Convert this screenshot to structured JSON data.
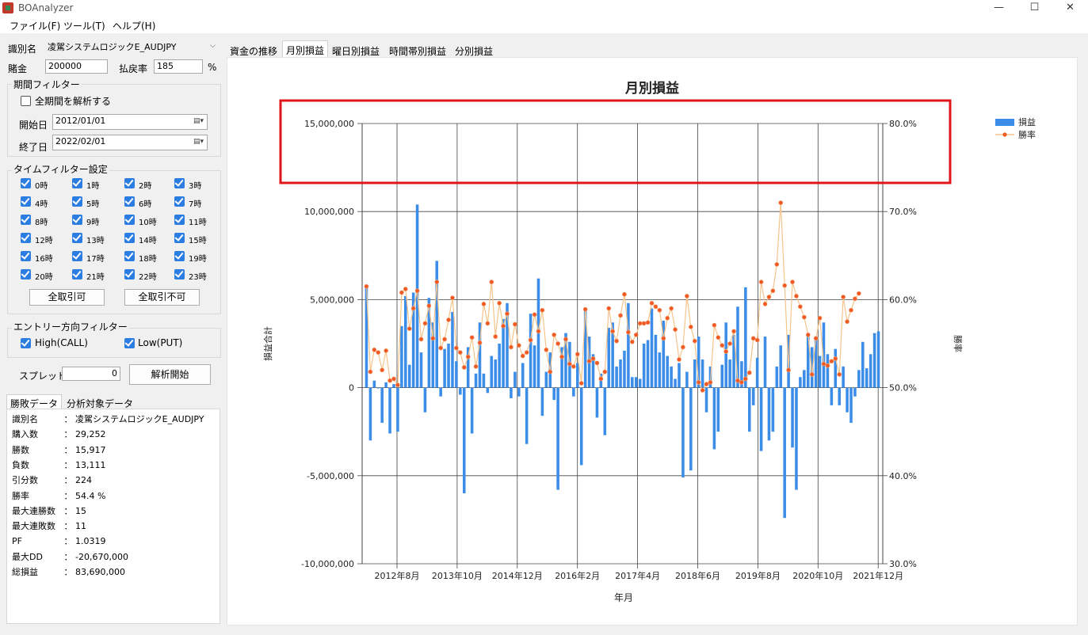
{
  "window": {
    "title": "BOAnalyzer"
  },
  "menu": [
    "ファイル(F)",
    "ツール(T)",
    "ヘルプ(H)"
  ],
  "controls": {
    "id_label": "識別名",
    "id_value": "凌駕システムロジックE_AUDJPY",
    "stake_label": "賭金",
    "stake_value": "200000",
    "payout_label": "払戻率",
    "payout_value": "185",
    "payout_unit": "%"
  },
  "period_filter": {
    "title": "期間フィルター",
    "all_period_label": "全期間を解析する",
    "all_period_checked": false,
    "start_label": "開始日",
    "start_value": "2012/01/01",
    "end_label": "終了日",
    "end_value": "2022/02/01"
  },
  "time_filter": {
    "title": "タイムフィルター設定",
    "hours": [
      "0時",
      "1時",
      "2時",
      "3時",
      "4時",
      "5時",
      "6時",
      "7時",
      "8時",
      "9時",
      "10時",
      "11時",
      "12時",
      "13時",
      "14時",
      "15時",
      "16時",
      "17時",
      "18時",
      "19時",
      "20時",
      "21時",
      "22時",
      "23時"
    ],
    "allow_all": "全取引可",
    "deny_all": "全取引不可"
  },
  "entry_filter": {
    "title": "エントリー方向フィルター",
    "high_label": "High(CALL)",
    "low_label": "Low(PUT)"
  },
  "spread": {
    "label": "スプレッド",
    "value": "0",
    "analyze_button": "解析開始"
  },
  "stats_tabs": [
    "勝敗データ",
    "分析対象データ"
  ],
  "stats": [
    {
      "key": "識別名",
      "value": "凌駕システムロジックE_AUDJPY"
    },
    {
      "key": "購入数",
      "value": "29,252"
    },
    {
      "key": "勝数",
      "value": "15,917"
    },
    {
      "key": "負数",
      "value": "13,111"
    },
    {
      "key": "引分数",
      "value": "224"
    },
    {
      "key": "勝率",
      "value": "54.4 %"
    },
    {
      "key": "最大連勝数",
      "value": "15"
    },
    {
      "key": "最大連敗数",
      "value": "11"
    },
    {
      "key": "PF",
      "value": "1.0319"
    },
    {
      "key": "最大DD",
      "value": "-20,670,000"
    },
    {
      "key": "総損益",
      "value": "83,690,000"
    }
  ],
  "chart_tabs": [
    "資金の推移",
    "月別損益",
    "曜日別損益",
    "時間帯別損益",
    "分別損益"
  ],
  "active_chart_tab": 1,
  "colors": {
    "bar": "#3c8de8",
    "line": "#f5c48a",
    "marker": "#ef5a24",
    "highlight": "#e0151a"
  },
  "chart_data": {
    "type": "bar",
    "title": "月別損益",
    "xlabel": "年月",
    "ylabel": "損益合計",
    "y2label": "勝率",
    "ylim": [
      -10000000,
      15000000
    ],
    "y2lim": [
      30,
      80
    ],
    "y_ticks": [
      "15,000,000",
      "10,000,000",
      "5,000,000",
      "0",
      "-5,000,000",
      "-10,000,000"
    ],
    "y2_ticks": [
      "80.0%",
      "70.0%",
      "60.0%",
      "50.0%",
      "40.0%",
      "30.0%"
    ],
    "x_ticks": [
      "2012年8月",
      "2013年10月",
      "2014年12月",
      "2016年2月",
      "2017年4月",
      "2018年6月",
      "2019年8月",
      "2020年10月",
      "2021年12月"
    ],
    "legend": [
      "損益",
      "勝率"
    ],
    "legend_position": "top-right",
    "grid": true,
    "series": [
      {
        "name": "損益",
        "type": "bar",
        "values": [
          5800000,
          -3000000,
          400000,
          0,
          -2000000,
          300000,
          -2600000,
          200000,
          -2500000,
          3500000,
          5200000,
          1300000,
          5400000,
          10400000,
          2000000,
          -1400000,
          5100000,
          3700000,
          7200000,
          -500000,
          2200000,
          2500000,
          4300000,
          1500000,
          -400000,
          -6000000,
          2300000,
          -2600000,
          800000,
          3700000,
          800000,
          -300000,
          1800000,
          1600000,
          2500000,
          3900000,
          4800000,
          -600000,
          900000,
          -500000,
          1400000,
          -3200000,
          4200000,
          2400000,
          6200000,
          -1600000,
          900000,
          2000000,
          -700000,
          -5800000,
          2300000,
          3100000,
          2600000,
          -500000,
          1400000,
          -4400000,
          4400000,
          2900000,
          1900000,
          -1700000,
          800000,
          -2700000,
          3400000,
          3700000,
          1200000,
          1600000,
          2100000,
          4800000,
          600000,
          600000,
          500000,
          2500000,
          2700000,
          4500000,
          3000000,
          2000000,
          3800000,
          1800000,
          1200000,
          500000,
          1400000,
          -5100000,
          900000,
          -4700000,
          1600000,
          2900000,
          1600000,
          -1400000,
          1200000,
          -3500000,
          -2500000,
          1300000,
          3700000,
          1600000,
          3000000,
          4600000,
          1500000,
          5700000,
          -2500000,
          -1000000,
          1700000,
          -3600000,
          2900000,
          -3000000,
          -2500000,
          1200000,
          2400000,
          -7400000,
          3000000,
          -3400000,
          -5800000,
          600000,
          1000000,
          3000000,
          2300000,
          2900000,
          1800000,
          3700000,
          1900000,
          -1000000,
          2200000,
          -1000000,
          1200000,
          -1400000,
          -2000000,
          -500000,
          1000000,
          2600000,
          1100000,
          1900000,
          3100000,
          3200000
        ]
      },
      {
        "name": "勝率",
        "type": "line",
        "values": [
          61.5,
          51.8,
          54.3,
          54.0,
          52.0,
          54.2,
          50.8,
          51.0,
          50.3,
          60.8,
          61.2,
          56.7,
          59.0,
          61.0,
          55.5,
          57.3,
          59.3,
          55.6,
          62.0,
          54.5,
          55.5,
          57.7,
          60.2,
          54.5,
          54.0,
          52.3,
          53.5,
          55.7,
          52.4,
          55.1,
          59.5,
          57.3,
          62.0,
          55.8,
          59.6,
          57.0,
          58.4,
          54.6,
          57.2,
          54.8,
          53.6,
          54.0,
          55.4,
          58.3,
          56.4,
          58.8,
          54.3,
          51.8,
          56.0,
          55.0,
          53.5,
          55.5,
          52.7,
          52.4,
          53.8,
          50.5,
          58.9,
          53.0,
          53.3,
          52.8,
          51.0,
          51.8,
          59.0,
          56.4,
          55.3,
          58.2,
          60.6,
          56.3,
          55.2,
          56.0,
          57.3,
          57.3,
          57.4,
          59.6,
          59.2,
          58.8,
          55.6,
          57.9,
          59.0,
          56.6,
          53.2,
          54.6,
          60.4,
          56.9,
          55.3,
          50.6,
          49.7,
          50.4,
          50.6,
          57.1,
          55.7,
          54.8,
          54.1,
          55.0,
          56.4,
          50.8,
          50.6,
          51.0,
          51.7,
          55.6,
          55.4,
          62.0,
          59.5,
          60.3,
          61.0,
          64.0,
          71.0,
          61.6,
          52.0,
          62.0,
          60.4,
          59.2,
          58.0,
          56.0,
          51.5,
          55.6,
          57.9,
          52.7,
          52.5,
          53.0,
          53.3,
          51.5,
          60.3,
          57.5,
          58.8,
          60.1,
          60.7
        ]
      }
    ]
  }
}
